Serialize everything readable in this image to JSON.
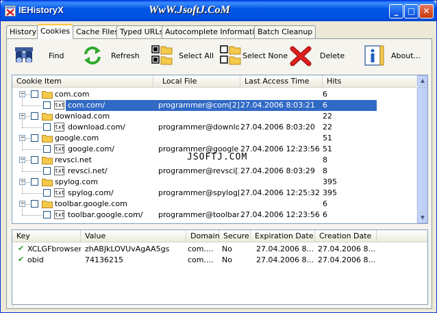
{
  "window": {
    "title": "IEHistoryX",
    "watermark": "WwW.JsoftJ.CoM",
    "min_glyph": "_",
    "max_glyph": "□",
    "close_glyph": "✕"
  },
  "tabs": [
    {
      "label": "History",
      "active": false
    },
    {
      "label": "Cookies",
      "active": true
    },
    {
      "label": "Cache Files",
      "active": false
    },
    {
      "label": "Typed URLs",
      "active": false
    },
    {
      "label": "Autocomplete Information",
      "active": false
    },
    {
      "label": "Batch Cleanup",
      "active": false
    }
  ],
  "toolbar": {
    "find": {
      "label": "Find",
      "icon": "binoculars-icon"
    },
    "refresh": {
      "label": "Refresh",
      "icon": "refresh-arrows-icon"
    },
    "select_all": {
      "label": "Select All",
      "icon": "select-all-icon"
    },
    "select_none": {
      "label": "Select None",
      "icon": "select-none-icon"
    },
    "delete": {
      "label": "Delete",
      "icon": "red-x-icon"
    },
    "about": {
      "label": "About...",
      "icon": "info-icon"
    }
  },
  "cookies_list": {
    "columns": [
      "Cookie Item",
      "Local File",
      "Last Access Time",
      "Hits"
    ],
    "rows": [
      {
        "type": "domain",
        "name": "com.com",
        "local_file": "",
        "last_access": "",
        "hits": "6"
      },
      {
        "type": "file",
        "name": "com.com/",
        "local_file": "programmer@com[2]....",
        "last_access": "27.04.2006 8:03:21",
        "hits": "6",
        "selected": true
      },
      {
        "type": "domain",
        "name": "download.com",
        "local_file": "",
        "last_access": "",
        "hits": "22"
      },
      {
        "type": "file",
        "name": "download.com/",
        "local_file": "programmer@downlo...",
        "last_access": "27.04.2006 8:03:20",
        "hits": "22"
      },
      {
        "type": "domain",
        "name": "google.com",
        "local_file": "",
        "last_access": "",
        "hits": "51"
      },
      {
        "type": "file",
        "name": "google.com/",
        "local_file": "programmer@google[...",
        "last_access": "27.04.2006 12:23:56",
        "hits": "51"
      },
      {
        "type": "domain",
        "name": "revsci.net",
        "local_file": "",
        "last_access": "",
        "hits": "8"
      },
      {
        "type": "file",
        "name": "revsci.net/",
        "local_file": "programmer@revsci[2...",
        "last_access": "27.04.2006 8:03:29",
        "hits": "8"
      },
      {
        "type": "domain",
        "name": "spylog.com",
        "local_file": "",
        "last_access": "",
        "hits": "395"
      },
      {
        "type": "file",
        "name": "spylog.com/",
        "local_file": "programmer@spylog[...",
        "last_access": "27.04.2006 12:25:32",
        "hits": "395"
      },
      {
        "type": "domain",
        "name": "toolbar.google.com",
        "local_file": "",
        "last_access": "",
        "hits": "6"
      },
      {
        "type": "file",
        "name": "toolbar.google.com/",
        "local_file": "programmer@toolbar...",
        "last_access": "27.04.2006 12:23:56",
        "hits": "6"
      }
    ],
    "overlay_text": "JSOFTJ.COM",
    "expander_glyph": "−",
    "file_icon_text": "txt"
  },
  "values_list": {
    "columns": [
      "Key",
      "Value",
      "Domain",
      "Secure",
      "Expiration Date",
      "Creation Date"
    ],
    "rows": [
      {
        "key": "XCLGFbrowser",
        "value": "zhABJkLOVUvAgAA5gs",
        "domain": "com....",
        "secure": "No",
        "expiration": "27.04.2006 8...",
        "creation": "27.04.2006 8..."
      },
      {
        "key": "obid",
        "value": "74136215",
        "domain": "com....",
        "secure": "No",
        "expiration": "27.04.2006 8...",
        "creation": "27.04.2006 8..."
      }
    ],
    "check_glyph": "✔"
  },
  "scrollbar": {
    "up_glyph": "▲",
    "down_glyph": "▼"
  },
  "colors": {
    "selection": "#316ac5",
    "folder": "#f5c94b",
    "accent_tab": "#ffc83c"
  }
}
